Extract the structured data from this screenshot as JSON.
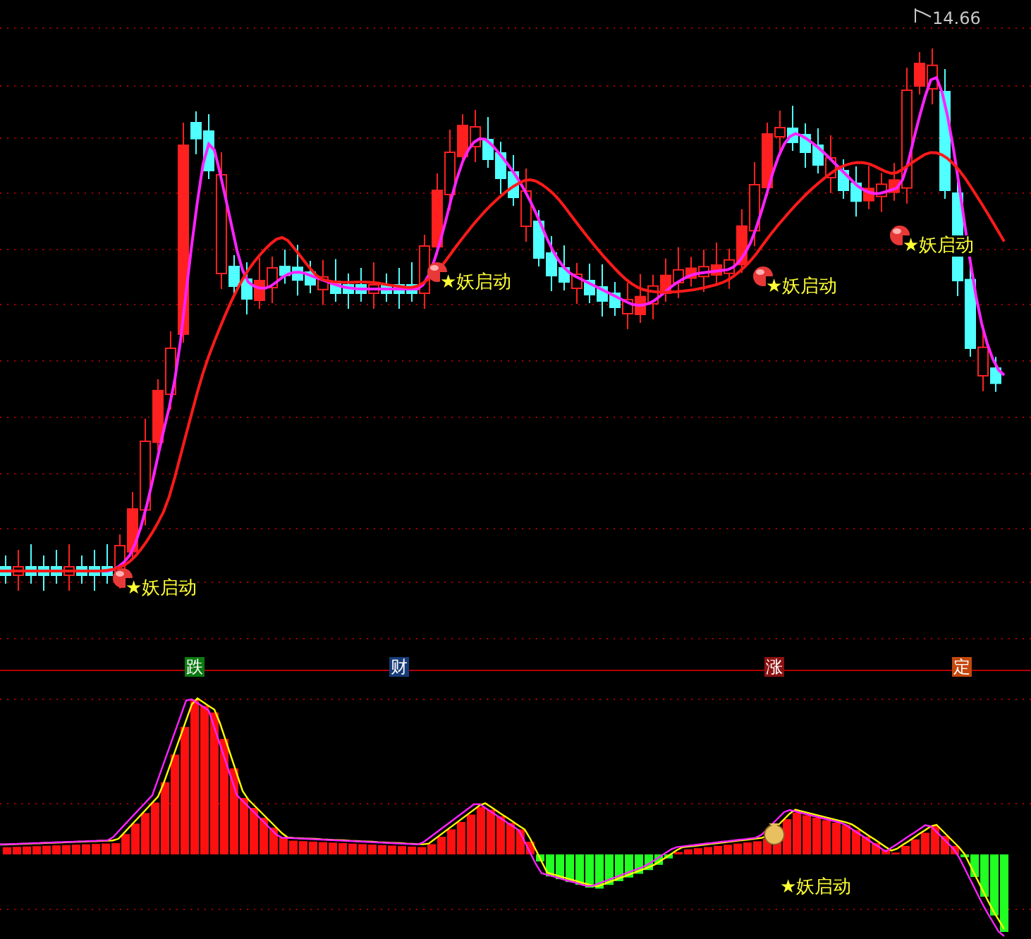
{
  "price_chart": {
    "high_label": "14.66",
    "signals": [
      {
        "label": "★妖启动"
      },
      {
        "label": "★妖启动"
      },
      {
        "label": "★妖启动"
      },
      {
        "label": "★妖启动"
      }
    ]
  },
  "markers": [
    {
      "label": "跌",
      "color": "#0b7a12"
    },
    {
      "label": "财",
      "color": "#173a78"
    },
    {
      "label": "涨",
      "color": "#8c1212"
    },
    {
      "label": "定",
      "color": "#c4480e"
    }
  ],
  "indicator": {
    "signals": [
      {
        "label": "★妖启动"
      }
    ]
  }
}
